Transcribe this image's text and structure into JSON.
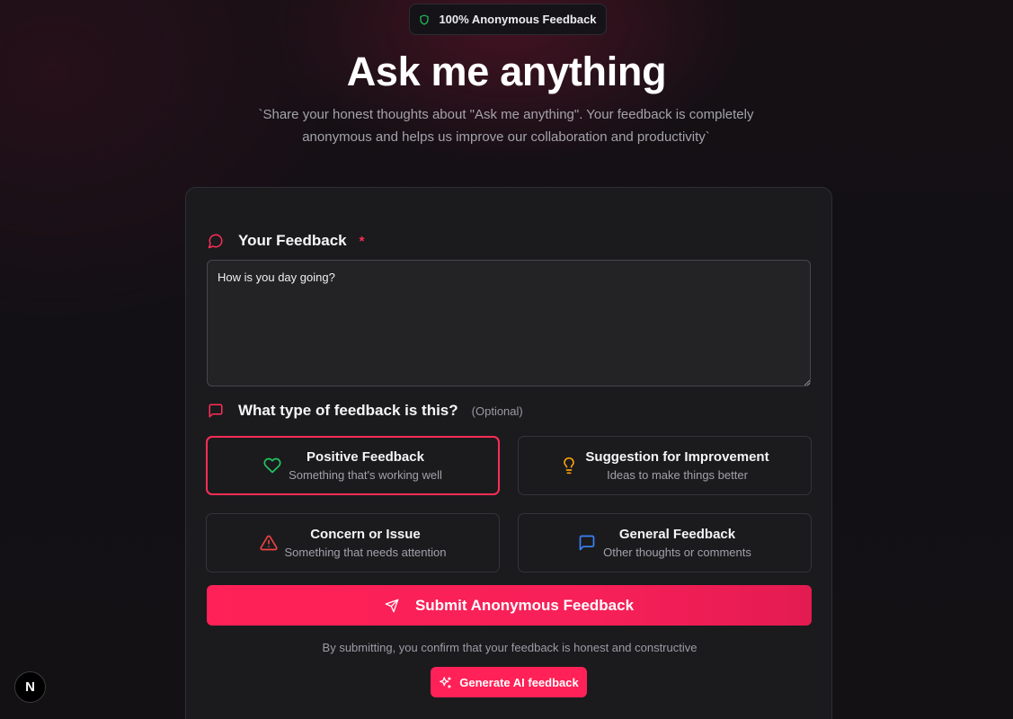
{
  "badge": {
    "label": "100% Anonymous Feedback",
    "icon": "shield-icon"
  },
  "header": {
    "title": "Ask me anything",
    "subtitle_line1": "`Share your honest thoughts about \"Ask me anything\". Your feedback is completely",
    "subtitle_line2": "anonymous and helps us improve our collaboration and productivity`"
  },
  "feedback": {
    "label": "Your Feedback",
    "required_mark": "*",
    "value": "How is you day going?"
  },
  "type": {
    "label": "What type of feedback is this?",
    "optional": "(Optional)",
    "options": [
      {
        "title": "Positive Feedback",
        "desc": "Something that's working well",
        "icon": "heart-icon",
        "color": "#22c55e",
        "selected": true
      },
      {
        "title": "Suggestion for Improvement",
        "desc": "Ideas to make things better",
        "icon": "lightbulb-icon",
        "color": "#f59e0b",
        "selected": false
      },
      {
        "title": "Concern or Issue",
        "desc": "Something that needs attention",
        "icon": "warning-icon",
        "color": "#ef4444",
        "selected": false
      },
      {
        "title": "General Feedback",
        "desc": "Other thoughts or comments",
        "icon": "message-square-icon",
        "color": "#3b82f6",
        "selected": false
      }
    ]
  },
  "submit": {
    "label": "Submit Anonymous Feedback"
  },
  "note": "By submitting, you confirm that your feedback is honest and constructive",
  "ai_button": {
    "label": "Generate AI feedback"
  },
  "next_badge": {
    "letter": "N"
  },
  "colors": {
    "accent": "#ff2157",
    "card": "#1b1b1e"
  }
}
